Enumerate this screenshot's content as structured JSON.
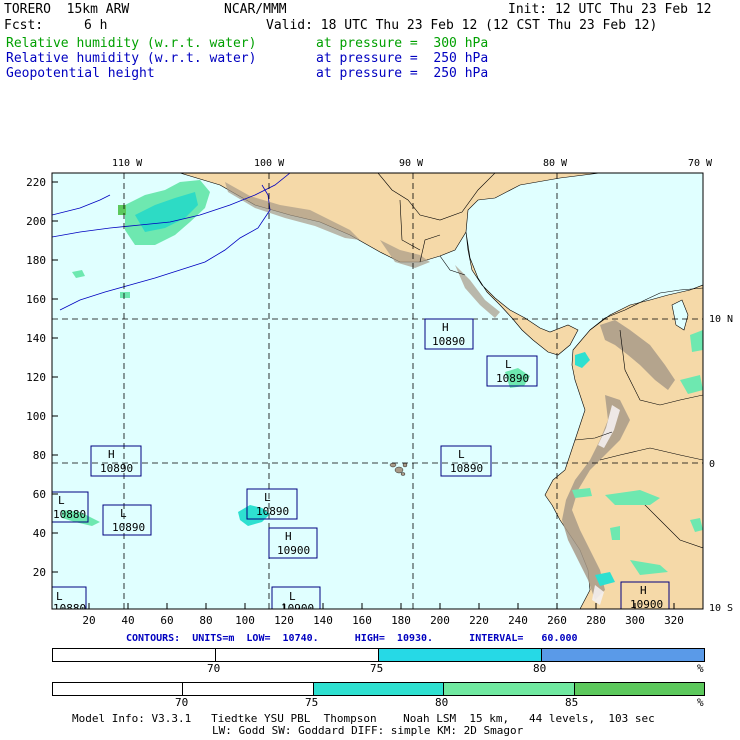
{
  "header": {
    "model": "TORERO  15km ARW",
    "center": "NCAR/MMM",
    "init": "Init: 12 UTC Thu 23 Feb 12",
    "fcst_label": "Fcst:",
    "fcst_value": "6 h",
    "valid": "Valid: 18 UTC Thu 23 Feb 12 (12 CST Thu 23 Feb 12)",
    "fields": [
      {
        "name": "Relative humidity (w.r.t. water)",
        "level": "at pressure =  300 hPa",
        "color": "#00a000"
      },
      {
        "name": "Relative humidity (w.r.t. water)",
        "level": "at pressure =  250 hPa",
        "color": "#0000c0"
      },
      {
        "name": "Geopotential height",
        "level": "at pressure =  250 hPa",
        "color": "#0000c0"
      }
    ]
  },
  "map": {
    "lon_labels": [
      "110 W",
      "100 W",
      "90 W",
      "80 W",
      "70 W"
    ],
    "lat_labels": [
      "10 N",
      "0",
      "10 S"
    ],
    "y_ticks": [
      "220",
      "200",
      "180",
      "160",
      "140",
      "120",
      "100",
      "80",
      "60",
      "40",
      "20"
    ],
    "x_ticks": [
      "20",
      "40",
      "60",
      "80",
      "100",
      "120",
      "140",
      "160",
      "180",
      "200",
      "220",
      "240",
      "260",
      "280",
      "300",
      "320"
    ],
    "height_marks": [
      {
        "letter": "H",
        "value": "10890"
      },
      {
        "letter": "L",
        "value": "10890"
      },
      {
        "letter": "H",
        "value": "10890"
      },
      {
        "letter": "L",
        "value": "10890"
      },
      {
        "letter": "L",
        "value": "10880"
      },
      {
        "letter": "L",
        "value": "10890"
      },
      {
        "letter": "L",
        "value": "10890"
      },
      {
        "letter": "H",
        "value": "10900"
      },
      {
        "letter": "L",
        "value": "10900"
      },
      {
        "letter": "L",
        "value": "10880"
      },
      {
        "letter": "H",
        "value": "10900"
      }
    ],
    "colors": {
      "ocean": "#e0ffff",
      "land": "#f5d9a8",
      "terrain": "#a89a88",
      "grid": "#000000",
      "contour": "#0000c0"
    }
  },
  "contours": {
    "units_label": "CONTOURS:  UNITS=m  LOW=  10740.      HIGH=  10930.      INTERVAL=   60.000"
  },
  "legend1": {
    "ticks": [
      "70",
      "75",
      "80",
      "%"
    ],
    "colors": [
      "#ffffff",
      "#ffffff",
      "#26d9e6",
      "#5a9ae8"
    ]
  },
  "legend2": {
    "ticks": [
      "70",
      "75",
      "80",
      "85",
      "%"
    ],
    "colors": [
      "#ffffff",
      "#ffffff",
      "#2ee0d0",
      "#70e8a0",
      "#5cc85c"
    ]
  },
  "model_info": {
    "line1": "Model Info: V3.3.1   Tiedtke YSU PBL  Thompson    Noah LSM  15 km,   44 levels,  103 sec",
    "line2": "LW: Godd SW: Goddard DIFF: simple KM: 2D Smagor"
  }
}
